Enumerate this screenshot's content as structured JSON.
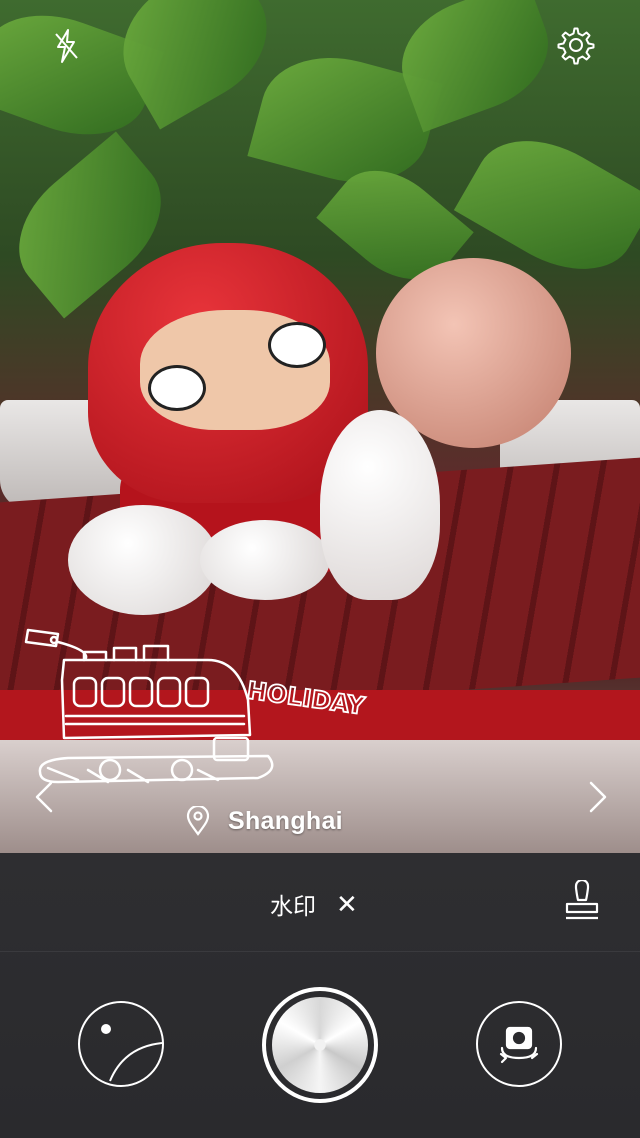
{
  "preview": {
    "location_label": "Shanghai",
    "watermark_text": "HOLIDAY"
  },
  "toolbar": {
    "flash_icon": "flash-off-icon",
    "settings_icon": "gear-icon"
  },
  "navigation": {
    "prev_icon": "chevron-left-icon",
    "next_icon": "chevron-right-icon"
  },
  "watermark_bar": {
    "label": "水印",
    "close_symbol": "✕",
    "stamp_icon": "stamp-icon"
  },
  "controls": {
    "album_icon": "album-icon",
    "shutter_icon": "shutter-icon",
    "switch_icon": "switch-camera-icon"
  },
  "colors": {
    "panel": "#2b2b2e",
    "accent": "#ffffff",
    "hood_red": "#b5131c"
  }
}
